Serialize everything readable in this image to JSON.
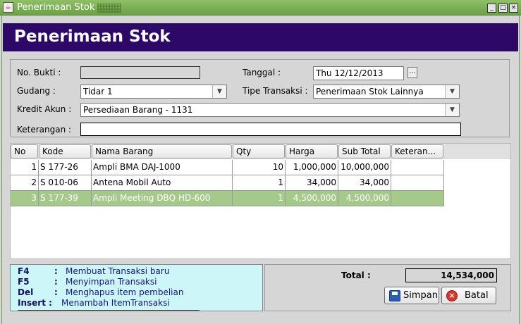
{
  "window": {
    "title": "Penerimaan Stok",
    "icon": "java-cup-icon",
    "controls": [
      "_",
      "□",
      "×"
    ]
  },
  "header": {
    "title": "Penerimaan Stok"
  },
  "form": {
    "no_bukti_label": "No. Bukti :",
    "no_bukti_value": "",
    "tanggal_label": "Tanggal :",
    "tanggal_value": "Thu 12/12/2013",
    "tanggal_button": "...",
    "gudang_label": "Gudang :",
    "gudang_value": "Tidar 1",
    "tipe_label": "Tipe Transaksi :",
    "tipe_value": "Penerimaan Stok Lainnya",
    "kredit_label": "Kredit Akun :",
    "kredit_value": "Persediaan Barang - 1131",
    "keterangan_label": "Keterangan :",
    "keterangan_value": "",
    "dropdown_glyph": "▼"
  },
  "table": {
    "columns": [
      "No",
      "Kode",
      "Nama Barang",
      "Qty",
      "Harga",
      "Sub Total",
      "Keteran..."
    ],
    "rows": [
      {
        "no": "1",
        "kode": "S 177-26",
        "nama": "Ampli BMA DAJ-1000",
        "qty": "10",
        "harga": "1,000,000",
        "subtotal": "10,000,000",
        "ket": ""
      },
      {
        "no": "2",
        "kode": "S 010-06",
        "nama": "Antena Mobil Auto",
        "qty": "1",
        "harga": "34,000",
        "subtotal": "34,000",
        "ket": ""
      },
      {
        "no": "3",
        "kode": "S 177-39",
        "nama": "Ampli Meeting DBQ HD-600",
        "qty": "1",
        "harga": "4,500,000",
        "subtotal": "4,500,000",
        "ket": ""
      }
    ],
    "selected_row": 3
  },
  "help": [
    {
      "key": "F4",
      "sep": ":",
      "desc": "Membuat Transaksi baru"
    },
    {
      "key": "F5",
      "sep": ":",
      "desc": "Menyimpan Transaksi"
    },
    {
      "key": "Del",
      "sep": ":",
      "desc": "Menghapus item pembelian"
    },
    {
      "key": "Insert :",
      "sep": "",
      "desc": "Menambah ItemTransaksi"
    }
  ],
  "totals": {
    "label": "Total :",
    "value": "14,534,000"
  },
  "buttons": {
    "save": "Simpan",
    "cancel": "Batal"
  },
  "colors": {
    "header_bg": "#2e0866",
    "titlebar": "#7aab52",
    "selected_row": "#a5c98a",
    "help_bg": "#ccf6f8"
  }
}
